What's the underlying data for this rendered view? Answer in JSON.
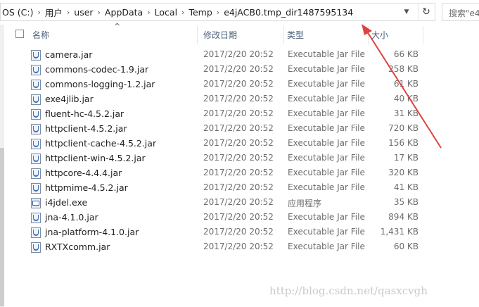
{
  "address_bar": {
    "breadcrumbs": [
      "OS (C:)",
      "用户",
      "user",
      "AppData",
      "Local",
      "Temp",
      "e4jACB0.tmp_dir1487595134"
    ],
    "separator": "›",
    "dropdown_icon": "chevron-down-icon",
    "refresh_icon": "refresh-icon"
  },
  "search": {
    "placeholder": "搜索\"e4"
  },
  "columns": {
    "name": "名称",
    "date": "修改日期",
    "type": "类型",
    "size": "大小"
  },
  "files": [
    {
      "name": "camera.jar",
      "date": "2017/2/20 20:52",
      "type": "Executable Jar File",
      "size": "66 KB",
      "icon": "jar-file-icon"
    },
    {
      "name": "commons-codec-1.9.jar",
      "date": "2017/2/20 20:52",
      "type": "Executable Jar File",
      "size": "258 KB",
      "icon": "jar-file-icon"
    },
    {
      "name": "commons-logging-1.2.jar",
      "date": "2017/2/20 20:52",
      "type": "Executable Jar File",
      "size": "61 KB",
      "icon": "jar-file-icon"
    },
    {
      "name": "exe4jlib.jar",
      "date": "2017/2/20 20:52",
      "type": "Executable Jar File",
      "size": "40 KB",
      "icon": "jar-file-icon"
    },
    {
      "name": "fluent-hc-4.5.2.jar",
      "date": "2017/2/20 20:52",
      "type": "Executable Jar File",
      "size": "31 KB",
      "icon": "jar-file-icon"
    },
    {
      "name": "httpclient-4.5.2.jar",
      "date": "2017/2/20 20:52",
      "type": "Executable Jar File",
      "size": "720 KB",
      "icon": "jar-file-icon"
    },
    {
      "name": "httpclient-cache-4.5.2.jar",
      "date": "2017/2/20 20:52",
      "type": "Executable Jar File",
      "size": "156 KB",
      "icon": "jar-file-icon"
    },
    {
      "name": "httpclient-win-4.5.2.jar",
      "date": "2017/2/20 20:52",
      "type": "Executable Jar File",
      "size": "17 KB",
      "icon": "jar-file-icon"
    },
    {
      "name": "httpcore-4.4.4.jar",
      "date": "2017/2/20 20:52",
      "type": "Executable Jar File",
      "size": "320 KB",
      "icon": "jar-file-icon"
    },
    {
      "name": "httpmime-4.5.2.jar",
      "date": "2017/2/20 20:52",
      "type": "Executable Jar File",
      "size": "41 KB",
      "icon": "jar-file-icon"
    },
    {
      "name": "i4jdel.exe",
      "date": "2017/2/20 20:52",
      "type": "应用程序",
      "size": "35 KB",
      "icon": "exe-file-icon"
    },
    {
      "name": "jna-4.1.0.jar",
      "date": "2017/2/20 20:52",
      "type": "Executable Jar File",
      "size": "894 KB",
      "icon": "jar-file-icon"
    },
    {
      "name": "jna-platform-4.1.0.jar",
      "date": "2017/2/20 20:52",
      "type": "Executable Jar File",
      "size": "1,431 KB",
      "icon": "jar-file-icon"
    },
    {
      "name": "RXTXcomm.jar",
      "date": "2017/2/20 20:52",
      "type": "Executable Jar File",
      "size": "60 KB",
      "icon": "jar-file-icon"
    }
  ],
  "annotation": {
    "arrow_color": "#e0413f"
  },
  "watermark": "http://blog.csdn.net/qasxcvgh"
}
